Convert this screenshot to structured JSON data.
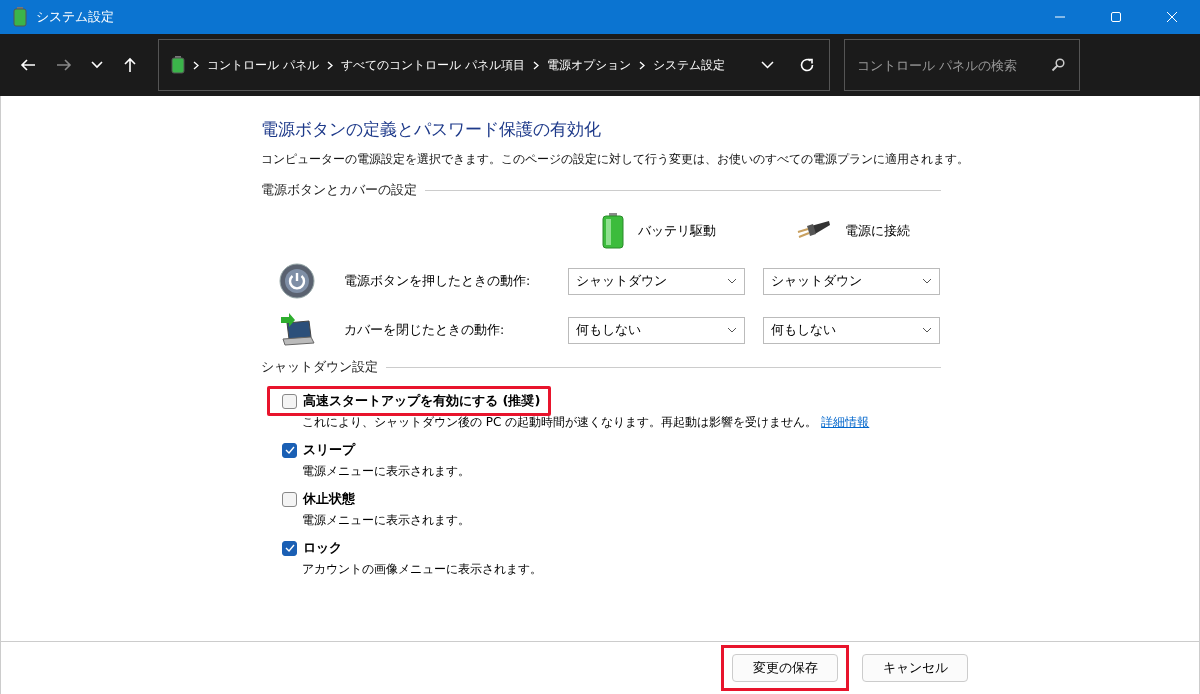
{
  "window": {
    "title": "システム設定"
  },
  "nav": {
    "breadcrumb": [
      "コントロール パネル",
      "すべてのコントロール パネル項目",
      "電源オプション",
      "システム設定"
    ],
    "search": {
      "placeholder": "コントロール パネルの検索"
    }
  },
  "page": {
    "heading": "電源ボタンの定義とパスワード保護の有効化",
    "description": "コンピューターの電源設定を選択できます。このページの設定に対して行う変更は、お使いのすべての電源プランに適用されます。",
    "power_section": {
      "title": "電源ボタンとカバーの設定",
      "columns": [
        {
          "kind": "battery",
          "label": "バッテリ駆動"
        },
        {
          "kind": "plug",
          "label": "電源に接続"
        }
      ],
      "rows": [
        {
          "kind": "power",
          "label": "電源ボタンを押したときの動作:",
          "values": [
            "シャットダウン",
            "シャットダウン"
          ]
        },
        {
          "kind": "lid",
          "label": "カバーを閉じたときの動作:",
          "values": [
            "何もしない",
            "何もしない"
          ]
        }
      ]
    },
    "shutdown_section": {
      "title": "シャットダウン設定",
      "options": [
        {
          "label": "高速スタートアップを有効にする (推奨)",
          "checked": false,
          "highlighted": true,
          "description": "これにより、シャットダウン後の PC の起動時間が速くなります。再起動は影響を受けません。",
          "link": "詳細情報"
        },
        {
          "label": "スリープ",
          "checked": true,
          "highlighted": false,
          "description": "電源メニューに表示されます。"
        },
        {
          "label": "休止状態",
          "checked": false,
          "highlighted": false,
          "description": "電源メニューに表示されます。"
        },
        {
          "label": "ロック",
          "checked": true,
          "highlighted": false,
          "description": "アカウントの画像メニューに表示されます。"
        }
      ]
    }
  },
  "buttons": [
    {
      "label": "変更の保存",
      "highlighted": true
    },
    {
      "label": "キャンセル",
      "highlighted": false
    }
  ]
}
